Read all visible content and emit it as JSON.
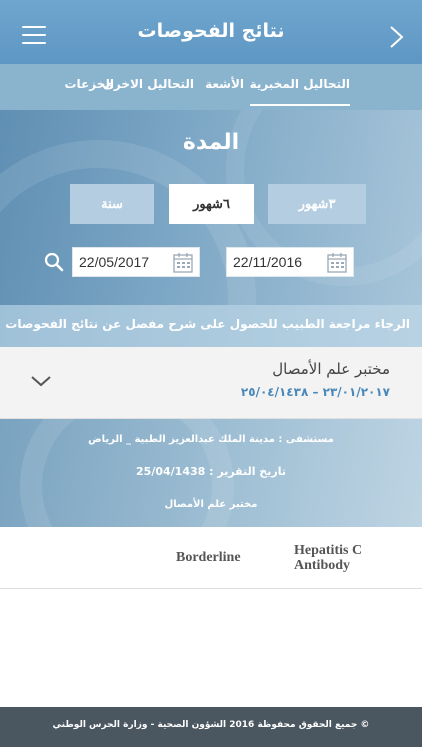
{
  "header": {
    "title": "نتائج الفحوصات",
    "menu_icon": "hamburger-menu-icon",
    "back_icon": "chevron-right-icon"
  },
  "tabs": [
    {
      "label": "التحاليل المخبرية",
      "active": true
    },
    {
      "label": "الأشعة",
      "active": false
    },
    {
      "label": "التحاليل الاخرى",
      "active": false
    },
    {
      "label": "الخزعات",
      "active": false
    }
  ],
  "filter": {
    "title": "المدة",
    "periods": [
      {
        "label": "٣شهور",
        "active": false
      },
      {
        "label": "٦شهور",
        "active": true
      },
      {
        "label": "سنة",
        "active": false
      }
    ],
    "date_from": "22/11/2016",
    "date_to": "22/05/2017",
    "calendar_icon": "calendar-icon",
    "search_icon": "search-icon"
  },
  "notice": {
    "text": "الرجاء مراجعة الطبيب للحصول على شرح مفصل عن نتائج الفحوصات"
  },
  "lab_card": {
    "name": "مختبر علم الأمصال",
    "date_range": "٢٣/٠١/٢٠١٧ – ٢٥/٠٤/١٤٣٨",
    "expand_icon": "chevron-down-icon"
  },
  "detail": {
    "hospital": "مستشفى : مدينة الملك عبدالعزيز الطبية _ الرياض",
    "report_date": "تاريخ التقرير : 25/04/1438",
    "lab": "مختبر علم الأمصال"
  },
  "result": {
    "test_name": "Hepatitis C Antibody",
    "value": "Borderline"
  },
  "footer": {
    "text": "© جميع الحقوق محفوظة 2016 الشؤون الصحية - وزارة الحرس الوطني"
  },
  "colors": {
    "header": "#5e97c3",
    "tabs": "#8ab3ce",
    "accent_date": "#4a88b9",
    "footer": "#4a5660"
  }
}
